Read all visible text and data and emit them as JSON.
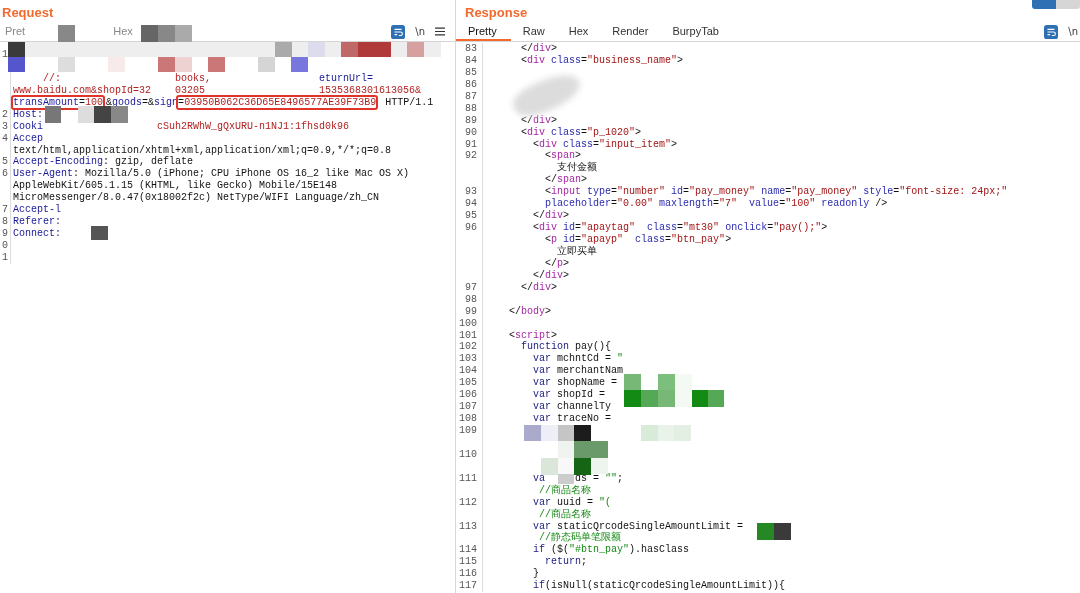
{
  "request": {
    "title": "Request",
    "tabs": [
      {
        "label": "Pret",
        "selected": false
      },
      {
        "label": "Hex",
        "selected": false
      }
    ],
    "newline_toggle": "\\n",
    "lines": [
      {
        "n": "1",
        "wrapped": true
      },
      {
        "segs": [
          {
            "kind": "value",
            "text": "     //:"
          },
          {
            "kind": "value",
            "text": "                   books,"
          },
          {
            "kind": "name",
            "text": "                  eturnUrl="
          }
        ]
      },
      {
        "segs": [
          {
            "kind": "value",
            "text": "www.baidu.com&shopId=32"
          },
          {
            "kind": "value",
            "text": "    03205"
          },
          {
            "kind": "value",
            "text": "                   1535368301613056&"
          }
        ]
      },
      {
        "segs": [
          {
            "kind": "name",
            "text": "transAmount",
            "annotated": true
          },
          {
            "kind": "plain",
            "text": "=",
            "annotated": true
          },
          {
            "kind": "value",
            "text": "100",
            "annotated": true
          },
          {
            "kind": "plain",
            "text": "&"
          },
          {
            "kind": "name",
            "text": "goods"
          },
          {
            "kind": "plain",
            "text": "=&"
          },
          {
            "kind": "name",
            "text": "sign"
          },
          {
            "kind": "plain",
            "text": "=",
            "annotated": true
          },
          {
            "kind": "value",
            "text": "03950B062C36D65E8496577AE39F73B9",
            "annotated": true
          },
          {
            "kind": "plain",
            "text": " HTTP/1.1"
          }
        ]
      },
      {
        "n": "2",
        "segs": [
          {
            "kind": "name",
            "text": "Host:"
          }
        ]
      },
      {
        "n": "3",
        "segs": [
          {
            "kind": "name",
            "text": "Cooki"
          },
          {
            "kind": "value",
            "text": "                   cSuh2RWhW_gQxURU-n1NJ1:1fhsd0k96"
          }
        ]
      },
      {
        "n": "4",
        "segs": [
          {
            "kind": "name",
            "text": "Accep"
          }
        ]
      },
      {
        "segs": [
          {
            "kind": "plain",
            "text": "text/html,application/xhtml+xml,application/xml;q=0.9,*/*;q=0.8"
          }
        ]
      },
      {
        "n": "5",
        "segs": [
          {
            "kind": "name",
            "text": "Accept-Encoding"
          },
          {
            "kind": "plain",
            "text": ": gzip, deflate"
          }
        ]
      },
      {
        "n": "6",
        "segs": [
          {
            "kind": "name",
            "text": "User-Agent"
          },
          {
            "kind": "plain",
            "text": ": Mozilla/5.0 (iPhone; CPU iPhone OS 16_2 like Mac OS X)"
          }
        ]
      },
      {
        "segs": [
          {
            "kind": "plain",
            "text": "AppleWebKit/605.1.15 (KHTML, like Gecko) Mobile/15E148"
          }
        ]
      },
      {
        "segs": [
          {
            "kind": "plain",
            "text": "MicroMessenger/8.0.47(0x18002f2c) NetType/WIFI Language/zh_CN"
          }
        ]
      },
      {
        "n": "7",
        "segs": [
          {
            "kind": "name",
            "text": "Accept-l"
          }
        ]
      },
      {
        "n": "8",
        "segs": [
          {
            "kind": "name",
            "text": "Referer:"
          }
        ]
      },
      {
        "n": "9",
        "segs": [
          {
            "kind": "name",
            "text": "Connect:"
          }
        ]
      },
      {
        "n": "0"
      },
      {
        "n": "1"
      }
    ]
  },
  "response": {
    "title": "Response",
    "tabs": [
      {
        "label": "Pretty",
        "selected": true
      },
      {
        "label": "Raw",
        "selected": false
      },
      {
        "label": "Hex",
        "selected": false
      },
      {
        "label": "Render",
        "selected": false
      },
      {
        "label": "BurpyTab",
        "selected": false
      }
    ],
    "newline_toggle": "\\n",
    "lines": [
      {
        "n": "83",
        "segs": [
          {
            "kind": "plain",
            "text": "    </"
          },
          {
            "kind": "tag",
            "text": "div"
          },
          {
            "kind": "plain",
            "text": ">"
          }
        ]
      },
      {
        "n": "84",
        "segs": [
          {
            "kind": "plain",
            "text": "    <"
          },
          {
            "kind": "tag",
            "text": "div"
          },
          {
            "kind": "attr",
            "text": " class"
          },
          {
            "kind": "plain",
            "text": "="
          },
          {
            "kind": "string",
            "text": "\"business_name\""
          },
          {
            "kind": "plain",
            "text": ">"
          }
        ]
      },
      {
        "n": "85"
      },
      {
        "n": "86"
      },
      {
        "n": "87"
      },
      {
        "n": "88"
      },
      {
        "n": "89",
        "segs": [
          {
            "kind": "plain",
            "text": "    </"
          },
          {
            "kind": "tag",
            "text": "div"
          },
          {
            "kind": "plain",
            "text": ">"
          }
        ]
      },
      {
        "n": "90",
        "segs": [
          {
            "kind": "plain",
            "text": "    <"
          },
          {
            "kind": "tag",
            "text": "div"
          },
          {
            "kind": "attr",
            "text": " class"
          },
          {
            "kind": "plain",
            "text": "="
          },
          {
            "kind": "string",
            "text": "\"p_1020\""
          },
          {
            "kind": "plain",
            "text": ">"
          }
        ]
      },
      {
        "n": "91",
        "segs": [
          {
            "kind": "plain",
            "text": "      <"
          },
          {
            "kind": "tag",
            "text": "div"
          },
          {
            "kind": "attr",
            "text": " class"
          },
          {
            "kind": "plain",
            "text": "="
          },
          {
            "kind": "string",
            "text": "\"input_item\""
          },
          {
            "kind": "plain",
            "text": ">"
          }
        ]
      },
      {
        "n": "92",
        "segs": [
          {
            "kind": "plain",
            "text": "        <"
          },
          {
            "kind": "tag",
            "text": "span"
          },
          {
            "kind": "plain",
            "text": ">"
          }
        ]
      },
      {
        "segs": [
          {
            "kind": "plain",
            "text": "          支付金额"
          }
        ]
      },
      {
        "segs": [
          {
            "kind": "plain",
            "text": "        </"
          },
          {
            "kind": "tag",
            "text": "span"
          },
          {
            "kind": "plain",
            "text": ">"
          }
        ]
      },
      {
        "n": "93",
        "segs": [
          {
            "kind": "plain",
            "text": "        <"
          },
          {
            "kind": "tag",
            "text": "input"
          },
          {
            "kind": "attr",
            "text": " type"
          },
          {
            "kind": "plain",
            "text": "="
          },
          {
            "kind": "string",
            "text": "\"number\""
          },
          {
            "kind": "attr",
            "text": " id"
          },
          {
            "kind": "plain",
            "text": "="
          },
          {
            "kind": "string",
            "text": "\"pay_money\""
          },
          {
            "kind": "attr",
            "text": " name"
          },
          {
            "kind": "plain",
            "text": "="
          },
          {
            "kind": "string",
            "text": "\"pay_money\""
          },
          {
            "kind": "attr",
            "text": " style"
          },
          {
            "kind": "plain",
            "text": "="
          },
          {
            "kind": "string",
            "text": "\"font-size: 24px;\""
          }
        ]
      },
      {
        "n": "94",
        "segs": [
          {
            "kind": "attr",
            "text": "        placeholder"
          },
          {
            "kind": "plain",
            "text": "="
          },
          {
            "kind": "string",
            "text": "\"0.00\""
          },
          {
            "kind": "attr",
            "text": " maxlength"
          },
          {
            "kind": "plain",
            "text": "="
          },
          {
            "kind": "string",
            "text": "\"7\""
          },
          {
            "kind": "attr",
            "text": "  value"
          },
          {
            "kind": "plain",
            "text": "="
          },
          {
            "kind": "string",
            "text": "\"100\""
          },
          {
            "kind": "attr",
            "text": " readonly"
          },
          {
            "kind": "plain",
            "text": " />"
          }
        ]
      },
      {
        "n": "95",
        "segs": [
          {
            "kind": "plain",
            "text": "      </"
          },
          {
            "kind": "tag",
            "text": "div"
          },
          {
            "kind": "plain",
            "text": ">"
          }
        ]
      },
      {
        "n": "96",
        "segs": [
          {
            "kind": "plain",
            "text": "      <"
          },
          {
            "kind": "tag",
            "text": "div"
          },
          {
            "kind": "attr",
            "text": " id"
          },
          {
            "kind": "plain",
            "text": "="
          },
          {
            "kind": "string",
            "text": "\"apaytag\""
          },
          {
            "kind": "attr",
            "text": "  class"
          },
          {
            "kind": "plain",
            "text": "="
          },
          {
            "kind": "string",
            "text": "\"mt30\""
          },
          {
            "kind": "attr",
            "text": " onclick"
          },
          {
            "kind": "plain",
            "text": "="
          },
          {
            "kind": "string",
            "text": "\"pay();\""
          },
          {
            "kind": "plain",
            "text": ">"
          }
        ]
      },
      {
        "segs": [
          {
            "kind": "plain",
            "text": "        <"
          },
          {
            "kind": "tag",
            "text": "p"
          },
          {
            "kind": "attr",
            "text": " id"
          },
          {
            "kind": "plain",
            "text": "="
          },
          {
            "kind": "string",
            "text": "\"apayp\""
          },
          {
            "kind": "attr",
            "text": "  class"
          },
          {
            "kind": "plain",
            "text": "="
          },
          {
            "kind": "string",
            "text": "\"btn_pay\""
          },
          {
            "kind": "plain",
            "text": ">"
          }
        ]
      },
      {
        "segs": [
          {
            "kind": "plain",
            "text": "          立即买单"
          }
        ]
      },
      {
        "segs": [
          {
            "kind": "plain",
            "text": "        </"
          },
          {
            "kind": "tag",
            "text": "p"
          },
          {
            "kind": "plain",
            "text": ">"
          }
        ]
      },
      {
        "segs": [
          {
            "kind": "plain",
            "text": "      </"
          },
          {
            "kind": "tag",
            "text": "div"
          },
          {
            "kind": "plain",
            "text": ">"
          }
        ]
      },
      {
        "n": "97",
        "segs": [
          {
            "kind": "plain",
            "text": "    </"
          },
          {
            "kind": "tag",
            "text": "div"
          },
          {
            "kind": "plain",
            "text": ">"
          }
        ]
      },
      {
        "n": "98"
      },
      {
        "n": "99",
        "segs": [
          {
            "kind": "plain",
            "text": "  </"
          },
          {
            "kind": "tag",
            "text": "body"
          },
          {
            "kind": "plain",
            "text": ">"
          }
        ]
      },
      {
        "n": "100"
      },
      {
        "n": "101",
        "segs": [
          {
            "kind": "plain",
            "text": "  <"
          },
          {
            "kind": "tag",
            "text": "script"
          },
          {
            "kind": "plain",
            "text": ">"
          }
        ]
      },
      {
        "n": "102",
        "segs": [
          {
            "kind": "keyword",
            "text": "    function"
          },
          {
            "kind": "plain",
            "text": " pay(){"
          }
        ]
      },
      {
        "n": "103",
        "segs": [
          {
            "kind": "keyword",
            "text": "      var"
          },
          {
            "kind": "plain",
            "text": " mchntCd = "
          },
          {
            "kind": "comment",
            "text": "\""
          }
        ]
      },
      {
        "n": "104",
        "segs": [
          {
            "kind": "keyword",
            "text": "      var"
          },
          {
            "kind": "plain",
            "text": " merchantNam"
          }
        ]
      },
      {
        "n": "105",
        "segs": [
          {
            "kind": "keyword",
            "text": "      var"
          },
          {
            "kind": "plain",
            "text": " shopName ="
          }
        ]
      },
      {
        "n": "106",
        "segs": [
          {
            "kind": "keyword",
            "text": "      var"
          },
          {
            "kind": "plain",
            "text": " shopId ="
          }
        ]
      },
      {
        "n": "107",
        "segs": [
          {
            "kind": "keyword",
            "text": "      var"
          },
          {
            "kind": "plain",
            "text": " channelTy"
          }
        ]
      },
      {
        "n": "108",
        "segs": [
          {
            "kind": "keyword",
            "text": "      var"
          },
          {
            "kind": "plain",
            "text": " traceNo ="
          }
        ]
      },
      {
        "n": "109",
        "wrapped": true
      },
      {
        "n": "110",
        "wrapped": true
      },
      {
        "n": "111",
        "segs": [
          {
            "kind": "keyword",
            "text": "      va"
          },
          {
            "kind": "plain",
            "text": "     ds = "
          },
          {
            "kind": "comment",
            "text": "\"\""
          },
          {
            "kind": "plain",
            "text": ";"
          }
        ]
      },
      {
        "segs": [
          {
            "kind": "comment",
            "text": "       //商品名称"
          }
        ]
      },
      {
        "n": "112",
        "segs": [
          {
            "kind": "keyword",
            "text": "      var"
          },
          {
            "kind": "plain",
            "text": " uuid = "
          },
          {
            "kind": "comment",
            "text": "\"("
          }
        ]
      },
      {
        "segs": [
          {
            "kind": "comment",
            "text": "       //商品名称"
          }
        ]
      },
      {
        "n": "113",
        "segs": [
          {
            "kind": "keyword",
            "text": "      var"
          },
          {
            "kind": "plain",
            "text": " staticQrcodeSingleAmountLimit ="
          }
        ]
      },
      {
        "segs": [
          {
            "kind": "comment",
            "text": "       //静态码单笔限额"
          }
        ]
      },
      {
        "n": "114",
        "segs": [
          {
            "kind": "keyword",
            "text": "      if"
          },
          {
            "kind": "plain",
            "text": " ($("
          },
          {
            "kind": "comment",
            "text": "\"#btn_pay\""
          },
          {
            "kind": "plain",
            "text": ").hasClass"
          }
        ]
      },
      {
        "n": "115",
        "segs": [
          {
            "kind": "keyword",
            "text": "        return"
          },
          {
            "kind": "plain",
            "text": ";"
          }
        ]
      },
      {
        "n": "116",
        "segs": [
          {
            "kind": "plain",
            "text": "      }"
          }
        ]
      },
      {
        "n": "117",
        "segs": [
          {
            "kind": "keyword",
            "text": "      if"
          },
          {
            "kind": "plain",
            "text": "(isNull(staticQrcodeSingleAmountLimit)){"
          }
        ]
      }
    ]
  }
}
